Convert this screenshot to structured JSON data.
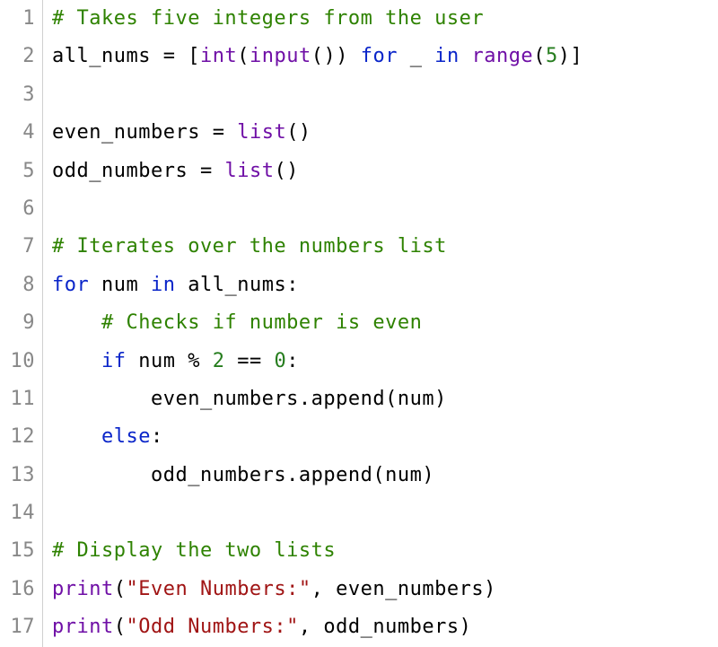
{
  "language": "python",
  "lines": [
    {
      "n": "1",
      "tokens": [
        {
          "t": "# Takes five integers from the user",
          "c": "comment"
        }
      ]
    },
    {
      "n": "2",
      "tokens": [
        {
          "t": "all_nums",
          "c": "ident"
        },
        {
          "t": " ",
          "c": "op"
        },
        {
          "t": "=",
          "c": "op"
        },
        {
          "t": " ",
          "c": "op"
        },
        {
          "t": "[",
          "c": "punc"
        },
        {
          "t": "int",
          "c": "builtin"
        },
        {
          "t": "(",
          "c": "punc"
        },
        {
          "t": "input",
          "c": "builtin"
        },
        {
          "t": "()",
          "c": "punc"
        },
        {
          "t": ")",
          "c": "punc"
        },
        {
          "t": " ",
          "c": "op"
        },
        {
          "t": "for",
          "c": "keyword"
        },
        {
          "t": " ",
          "c": "op"
        },
        {
          "t": "_",
          "c": "ident"
        },
        {
          "t": " ",
          "c": "op"
        },
        {
          "t": "in",
          "c": "keyword"
        },
        {
          "t": " ",
          "c": "op"
        },
        {
          "t": "range",
          "c": "builtin"
        },
        {
          "t": "(",
          "c": "punc"
        },
        {
          "t": "5",
          "c": "number"
        },
        {
          "t": ")",
          "c": "punc"
        },
        {
          "t": "]",
          "c": "punc"
        }
      ]
    },
    {
      "n": "3",
      "tokens": []
    },
    {
      "n": "4",
      "tokens": [
        {
          "t": "even_numbers",
          "c": "ident"
        },
        {
          "t": " ",
          "c": "op"
        },
        {
          "t": "=",
          "c": "op"
        },
        {
          "t": " ",
          "c": "op"
        },
        {
          "t": "list",
          "c": "builtin"
        },
        {
          "t": "()",
          "c": "punc"
        }
      ]
    },
    {
      "n": "5",
      "tokens": [
        {
          "t": "odd_numbers",
          "c": "ident"
        },
        {
          "t": " ",
          "c": "op"
        },
        {
          "t": "=",
          "c": "op"
        },
        {
          "t": " ",
          "c": "op"
        },
        {
          "t": "list",
          "c": "builtin"
        },
        {
          "t": "()",
          "c": "punc"
        }
      ]
    },
    {
      "n": "6",
      "tokens": []
    },
    {
      "n": "7",
      "tokens": [
        {
          "t": "# Iterates over the numbers list",
          "c": "comment"
        }
      ]
    },
    {
      "n": "8",
      "tokens": [
        {
          "t": "for",
          "c": "keyword"
        },
        {
          "t": " ",
          "c": "op"
        },
        {
          "t": "num",
          "c": "ident"
        },
        {
          "t": " ",
          "c": "op"
        },
        {
          "t": "in",
          "c": "keyword"
        },
        {
          "t": " ",
          "c": "op"
        },
        {
          "t": "all_nums",
          "c": "ident"
        },
        {
          "t": ":",
          "c": "punc"
        }
      ]
    },
    {
      "n": "9",
      "tokens": [
        {
          "t": "    ",
          "c": "op"
        },
        {
          "t": "# Checks if number is even",
          "c": "comment"
        }
      ]
    },
    {
      "n": "10",
      "tokens": [
        {
          "t": "    ",
          "c": "op"
        },
        {
          "t": "if",
          "c": "keyword"
        },
        {
          "t": " ",
          "c": "op"
        },
        {
          "t": "num",
          "c": "ident"
        },
        {
          "t": " ",
          "c": "op"
        },
        {
          "t": "%",
          "c": "op"
        },
        {
          "t": " ",
          "c": "op"
        },
        {
          "t": "2",
          "c": "number"
        },
        {
          "t": " ",
          "c": "op"
        },
        {
          "t": "==",
          "c": "op"
        },
        {
          "t": " ",
          "c": "op"
        },
        {
          "t": "0",
          "c": "number"
        },
        {
          "t": ":",
          "c": "punc"
        }
      ]
    },
    {
      "n": "11",
      "tokens": [
        {
          "t": "        ",
          "c": "op"
        },
        {
          "t": "even_numbers",
          "c": "ident"
        },
        {
          "t": ".",
          "c": "punc"
        },
        {
          "t": "append",
          "c": "ident"
        },
        {
          "t": "(",
          "c": "punc"
        },
        {
          "t": "num",
          "c": "ident"
        },
        {
          "t": ")",
          "c": "punc"
        }
      ]
    },
    {
      "n": "12",
      "tokens": [
        {
          "t": "    ",
          "c": "op"
        },
        {
          "t": "else",
          "c": "keyword"
        },
        {
          "t": ":",
          "c": "punc"
        }
      ]
    },
    {
      "n": "13",
      "tokens": [
        {
          "t": "        ",
          "c": "op"
        },
        {
          "t": "odd_numbers",
          "c": "ident"
        },
        {
          "t": ".",
          "c": "punc"
        },
        {
          "t": "append",
          "c": "ident"
        },
        {
          "t": "(",
          "c": "punc"
        },
        {
          "t": "num",
          "c": "ident"
        },
        {
          "t": ")",
          "c": "punc"
        }
      ]
    },
    {
      "n": "14",
      "tokens": []
    },
    {
      "n": "15",
      "tokens": [
        {
          "t": "# Display the two lists",
          "c": "comment"
        }
      ]
    },
    {
      "n": "16",
      "tokens": [
        {
          "t": "print",
          "c": "builtin"
        },
        {
          "t": "(",
          "c": "punc"
        },
        {
          "t": "\"Even Numbers:\"",
          "c": "string"
        },
        {
          "t": ",",
          "c": "punc"
        },
        {
          "t": " ",
          "c": "op"
        },
        {
          "t": "even_numbers",
          "c": "ident"
        },
        {
          "t": ")",
          "c": "punc"
        }
      ]
    },
    {
      "n": "17",
      "tokens": [
        {
          "t": "print",
          "c": "builtin"
        },
        {
          "t": "(",
          "c": "punc"
        },
        {
          "t": "\"Odd Numbers:\"",
          "c": "string"
        },
        {
          "t": ",",
          "c": "punc"
        },
        {
          "t": " ",
          "c": "op"
        },
        {
          "t": "odd_numbers",
          "c": "ident"
        },
        {
          "t": ")",
          "c": "punc"
        }
      ]
    }
  ]
}
